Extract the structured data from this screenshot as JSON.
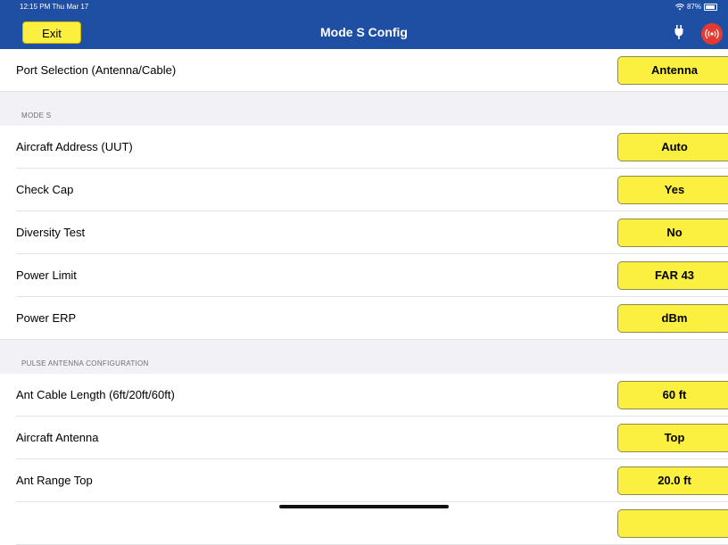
{
  "status_bar": {
    "time": "12:15 PM  Thu Mar 17",
    "battery": "87%",
    "battery_level": 0.87
  },
  "navbar": {
    "exit_label": "Exit",
    "title": "Mode S Config",
    "icons": [
      "plug-icon",
      "signal-broadcast-icon"
    ]
  },
  "rows_top": [
    {
      "label": "Port Selection (Antenna/Cable)",
      "value": "Antenna"
    }
  ],
  "mode_s": {
    "header": "MODE S",
    "rows": [
      {
        "label": "Aircraft Address (UUT)",
        "value": "Auto"
      },
      {
        "label": "Check Cap",
        "value": "Yes"
      },
      {
        "label": "Diversity Test",
        "value": "No"
      },
      {
        "label": "Power Limit",
        "value": "FAR 43"
      },
      {
        "label": "Power ERP",
        "value": "dBm"
      }
    ]
  },
  "pulse_antenna": {
    "header": "PULSE ANTENNA CONFIGURATION",
    "rows": [
      {
        "label": "Ant Cable Length (6ft/20ft/60ft)",
        "value": "60 ft"
      },
      {
        "label": "Aircraft Antenna",
        "value": "Top"
      },
      {
        "label": "Ant Range Top",
        "value": "20.0 ft"
      }
    ]
  },
  "colors": {
    "navbar": "#1f4fa3",
    "button": "#fbef3f",
    "signal": "#e53a30"
  }
}
